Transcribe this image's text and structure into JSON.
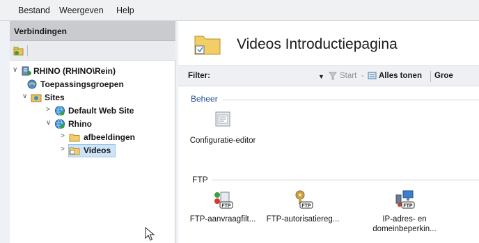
{
  "menu": {
    "items": [
      "Bestand",
      "Weergeven",
      "Help"
    ]
  },
  "connections": {
    "header": "Verbindingen",
    "tree": [
      {
        "label": "RHINO (RHINO\\Rein)",
        "level": 0,
        "expanded": true,
        "icon": "server-icon"
      },
      {
        "label": "Toepassingsgroepen",
        "level": 1,
        "icon": "app-pools-icon"
      },
      {
        "label": "Sites",
        "level": 1,
        "expanded": true,
        "icon": "sites-folder-icon"
      },
      {
        "label": "Default Web Site",
        "level": 2,
        "expanded": false,
        "icon": "globe-icon"
      },
      {
        "label": "Rhino",
        "level": 2,
        "expanded": true,
        "icon": "globe-icon"
      },
      {
        "label": "afbeeldingen",
        "level": 3,
        "expanded": false,
        "icon": "folder-icon"
      },
      {
        "label": "Videos",
        "level": 3,
        "expanded": false,
        "icon": "folder-icon",
        "selected": true
      }
    ]
  },
  "main": {
    "title": "Videos Introductiepagina",
    "filter": {
      "label": "Filter:",
      "start": "Start",
      "show_all": "Alles tonen",
      "group": "Groe"
    },
    "groups": [
      {
        "name": "Beheer",
        "features": [
          {
            "label": "Configuratie-editor",
            "icon": "config-editor-icon"
          }
        ]
      },
      {
        "name": "FTP",
        "features": [
          {
            "label": "FTP-aanvraagfilt...",
            "icon": "ftp-request-filter-icon"
          },
          {
            "label": "FTP-autorisatiereg...",
            "icon": "ftp-authorization-icon"
          },
          {
            "label": "IP-adres- en",
            "label2": "domeinbeperkin...",
            "icon": "ip-domain-restrictions-icon"
          }
        ]
      }
    ]
  }
}
